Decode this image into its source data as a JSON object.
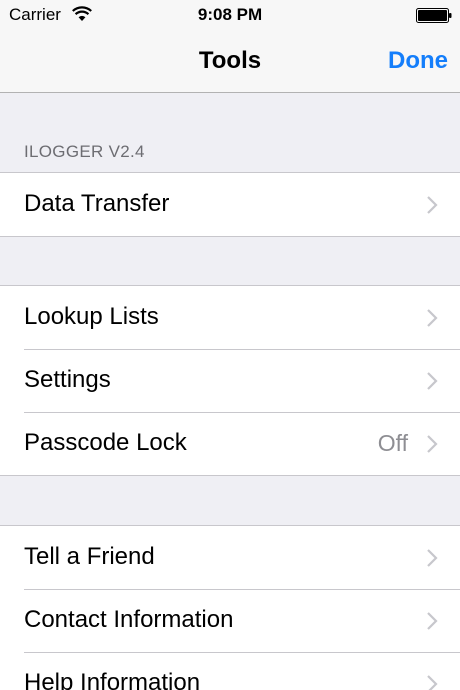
{
  "status_bar": {
    "carrier": "Carrier",
    "time": "9:08 PM",
    "wifi_icon": "wifi-icon",
    "battery_icon": "battery-icon"
  },
  "nav": {
    "title": "Tools",
    "done_label": "Done"
  },
  "section": {
    "header": "ILOGGER V2.4"
  },
  "groups": [
    {
      "rows": [
        {
          "label": "Data Transfer",
          "detail": ""
        }
      ]
    },
    {
      "rows": [
        {
          "label": "Lookup Lists",
          "detail": ""
        },
        {
          "label": "Settings",
          "detail": ""
        },
        {
          "label": "Passcode Lock",
          "detail": "Off"
        }
      ]
    },
    {
      "rows": [
        {
          "label": "Tell a Friend",
          "detail": ""
        },
        {
          "label": "Contact Information",
          "detail": ""
        },
        {
          "label": "Help Information",
          "detail": ""
        }
      ]
    }
  ],
  "colors": {
    "accent": "#147efb",
    "background": "#efeff4",
    "separator": "#c8c7cc",
    "detail_text": "#8e8e93",
    "chevron": "#c7c7cc"
  }
}
